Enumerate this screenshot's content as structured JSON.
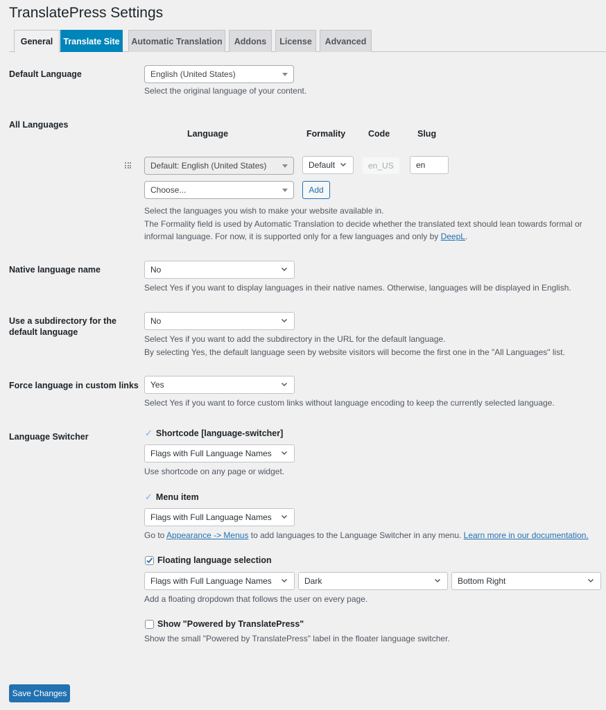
{
  "page": {
    "title": "TranslatePress Settings"
  },
  "tabs": [
    {
      "label": "General",
      "state": "active"
    },
    {
      "label": "Translate Site",
      "state": "highlight"
    },
    {
      "label": "Automatic Translation",
      "state": "normal"
    },
    {
      "label": "Addons",
      "state": "normal"
    },
    {
      "label": "License",
      "state": "normal"
    },
    {
      "label": "Advanced",
      "state": "normal"
    }
  ],
  "default_language": {
    "label": "Default Language",
    "value": "English (United States)",
    "description": "Select the original language of your content."
  },
  "all_languages": {
    "label": "All Languages",
    "columns": {
      "language": "Language",
      "formality": "Formality",
      "code": "Code",
      "slug": "Slug"
    },
    "rows": [
      {
        "language": "Default: English (United States)",
        "formality": "Default",
        "code": "en_US",
        "slug": "en"
      }
    ],
    "choose_placeholder": "Choose...",
    "add_label": "Add",
    "description_line1": "Select the languages you wish to make your website available in.",
    "description_line2": "The Formality field is used by Automatic Translation to decide whether the translated text should lean towards formal or",
    "description_line3": "informal language. For now, it is supported only for a few languages and only by ",
    "deepl_link": "DeepL",
    "description_end": "."
  },
  "native_language_name": {
    "label": "Native language name",
    "value": "No",
    "description": "Select Yes if you want to display languages in their native names. Otherwise, languages will be displayed in English."
  },
  "subdirectory": {
    "label_line1": "Use a subdirectory for the",
    "label_line2": "default language",
    "value": "No",
    "description_line1": "Select Yes if you want to add the subdirectory in the URL for the default language.",
    "description_line2": "By selecting Yes, the default language seen by website visitors will become the first one in the \"All Languages\" list."
  },
  "force_language": {
    "label": "Force language in custom links",
    "value": "Yes",
    "description": "Select Yes if you want to force custom links without language encoding to keep the currently selected language."
  },
  "language_switcher": {
    "label": "Language Switcher",
    "shortcode": {
      "label": "Shortcode [language-switcher]",
      "checked": true,
      "value": "Flags with Full Language Names",
      "description": "Use shortcode on any page or widget."
    },
    "menu_item": {
      "label": "Menu item",
      "checked": true,
      "value": "Flags with Full Language Names",
      "desc_prefix": "Go to ",
      "appearance_link": "Appearance -> Menus",
      "desc_middle": " to add languages to the Language Switcher in any menu. ",
      "docs_link": "Learn more in our documentation."
    },
    "floating": {
      "label": "Floating language selection",
      "checked": true,
      "style_value": "Flags with Full Language Names",
      "theme_value": "Dark",
      "position_value": "Bottom Right",
      "description": "Add a floating dropdown that follows the user on every page."
    },
    "powered_by": {
      "label": "Show \"Powered by TranslatePress\"",
      "checked": false,
      "description": "Show the small \"Powered by TranslatePress\" label in the floater language switcher."
    }
  },
  "footer": {
    "save_label": "Save Changes"
  },
  "colors": {
    "accent": "#2271b1",
    "tab_highlight": "#0085ba",
    "background": "#f0f0f1"
  }
}
